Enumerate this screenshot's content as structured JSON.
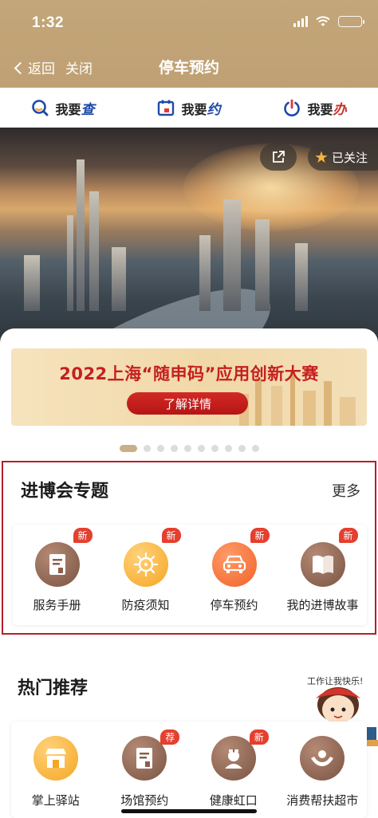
{
  "status_bar": {
    "time": "1:32"
  },
  "nav": {
    "back_label": "返回",
    "close_label": "关闭",
    "title": "停车预约"
  },
  "tabs": [
    {
      "prefix": "我要",
      "emphasis": "查",
      "icon": "search-magnifier-icon",
      "accent": "#1d4aa8"
    },
    {
      "prefix": "我要",
      "emphasis": "约",
      "icon": "calendar-icon",
      "accent": "#1d4aa8"
    },
    {
      "prefix": "我要",
      "emphasis": "办",
      "icon": "power-stamp-icon",
      "accent": "#c9322a"
    }
  ],
  "banner": {
    "follow_label": "已关注"
  },
  "promo": {
    "title": "2022上海“随申码”应用创新大赛",
    "button_label": "了解详情"
  },
  "carousel": {
    "total": 10,
    "active": 1
  },
  "expo_section": {
    "title": "进博会专题",
    "more_label": "更多",
    "items": [
      {
        "label": "服务手册",
        "badge": "新",
        "icon": "handbook-icon"
      },
      {
        "label": "防疫须知",
        "badge": "新",
        "icon": "virus-icon"
      },
      {
        "label": "停车预约",
        "badge": "新",
        "icon": "car-icon"
      },
      {
        "label": "我的进博故事",
        "badge": "新",
        "icon": "book-icon"
      }
    ]
  },
  "hot_section": {
    "title": "热门推荐",
    "mascot_caption": "工作让我快乐!",
    "items": [
      {
        "label": "掌上驿站",
        "badge": "",
        "icon": "shop-icon"
      },
      {
        "label": "场馆预约",
        "badge": "荐",
        "icon": "venue-icon"
      },
      {
        "label": "健康虹口",
        "badge": "新",
        "icon": "nurse-icon"
      },
      {
        "label": "消费帮扶超市",
        "badge": "",
        "icon": "hands-icon"
      }
    ]
  },
  "colors": {
    "header": "#c3a679",
    "brand_red": "#c51f1f",
    "badge_red": "#e53f2e",
    "highlight_border": "#b3202b"
  }
}
